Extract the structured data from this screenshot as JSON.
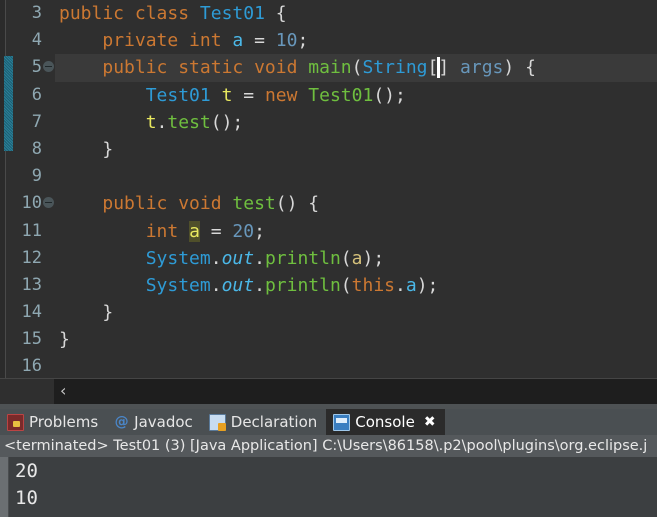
{
  "editor": {
    "first_line_number": 3,
    "current_line": 5,
    "fold_lines": [
      5,
      10
    ],
    "change_bar_lines": [
      5,
      8
    ],
    "line_numbers": [
      3,
      4,
      5,
      6,
      7,
      8,
      9,
      10,
      11,
      12,
      13,
      14,
      15,
      16
    ],
    "lines": [
      {
        "number": 3,
        "text": "public class Test01 {",
        "tokens": [
          {
            "t": "public class ",
            "c": "t-kw"
          },
          {
            "t": "Test01",
            "c": "t-type"
          },
          {
            "t": " {",
            "c": "t-pl"
          }
        ]
      },
      {
        "number": 4,
        "text": "    private int a = 10;",
        "tokens": [
          {
            "t": "    ",
            "c": "t-pl"
          },
          {
            "t": "private int ",
            "c": "t-kw"
          },
          {
            "t": "a",
            "c": "t-field"
          },
          {
            "t": " = ",
            "c": "t-pl"
          },
          {
            "t": "10",
            "c": "t-num"
          },
          {
            "t": ";",
            "c": "t-pl"
          }
        ]
      },
      {
        "number": 5,
        "text": "    public static void main(String[] args) {",
        "tokens": [
          {
            "t": "    ",
            "c": "t-pl"
          },
          {
            "t": "public static void ",
            "c": "t-kw"
          },
          {
            "t": "main",
            "c": "t-fn"
          },
          {
            "t": "(",
            "c": "t-pl"
          },
          {
            "t": "String",
            "c": "t-type"
          },
          {
            "t": "[",
            "c": "t-pl"
          },
          {
            "t": "CARET",
            "c": "caret"
          },
          {
            "t": "]",
            "c": "t-pl"
          },
          {
            "t": " ",
            "c": "t-pl"
          },
          {
            "t": "args",
            "c": "t-num"
          },
          {
            "t": ") {",
            "c": "t-pl"
          }
        ]
      },
      {
        "number": 6,
        "text": "        Test01 t = new Test01();",
        "tokens": [
          {
            "t": "        ",
            "c": "t-pl"
          },
          {
            "t": "Test01",
            "c": "t-type"
          },
          {
            "t": " ",
            "c": "t-pl"
          },
          {
            "t": "t",
            "c": "t-var"
          },
          {
            "t": " = ",
            "c": "t-pl"
          },
          {
            "t": "new",
            "c": "t-kw"
          },
          {
            "t": " ",
            "c": "t-pl"
          },
          {
            "t": "Test01",
            "c": "t-fn"
          },
          {
            "t": "();",
            "c": "t-pl"
          }
        ]
      },
      {
        "number": 7,
        "text": "        t.test();",
        "tokens": [
          {
            "t": "        ",
            "c": "t-pl"
          },
          {
            "t": "t",
            "c": "t-var"
          },
          {
            "t": ".",
            "c": "t-pl"
          },
          {
            "t": "test",
            "c": "t-fn"
          },
          {
            "t": "();",
            "c": "t-pl"
          }
        ]
      },
      {
        "number": 8,
        "text": "    }",
        "tokens": [
          {
            "t": "    }",
            "c": "t-pl"
          }
        ]
      },
      {
        "number": 9,
        "text": "",
        "tokens": [
          {
            "t": "",
            "c": "t-pl"
          }
        ]
      },
      {
        "number": 10,
        "text": "    public void test() {",
        "tokens": [
          {
            "t": "    ",
            "c": "t-pl"
          },
          {
            "t": "public void ",
            "c": "t-kw"
          },
          {
            "t": "test",
            "c": "t-fn"
          },
          {
            "t": "() {",
            "c": "t-pl"
          }
        ]
      },
      {
        "number": 11,
        "text": "        int a = 20;",
        "tokens": [
          {
            "t": "        ",
            "c": "t-pl"
          },
          {
            "t": "int",
            "c": "t-kw"
          },
          {
            "t": " ",
            "c": "t-pl"
          },
          {
            "t": "a",
            "c": "t-hl"
          },
          {
            "t": " = ",
            "c": "t-pl"
          },
          {
            "t": "20",
            "c": "t-num"
          },
          {
            "t": ";",
            "c": "t-pl"
          }
        ]
      },
      {
        "number": 12,
        "text": "        System.out.println(a);",
        "tokens": [
          {
            "t": "        ",
            "c": "t-pl"
          },
          {
            "t": "System",
            "c": "t-type"
          },
          {
            "t": ".",
            "c": "t-pl"
          },
          {
            "t": "out",
            "c": "t-field t-italic"
          },
          {
            "t": ".",
            "c": "t-pl"
          },
          {
            "t": "println",
            "c": "t-fn"
          },
          {
            "t": "(",
            "c": "t-pl"
          },
          {
            "t": "a",
            "c": "t-hl2"
          },
          {
            "t": ");",
            "c": "t-pl"
          }
        ]
      },
      {
        "number": 13,
        "text": "        System.out.println(this.a);",
        "tokens": [
          {
            "t": "        ",
            "c": "t-pl"
          },
          {
            "t": "System",
            "c": "t-type"
          },
          {
            "t": ".",
            "c": "t-pl"
          },
          {
            "t": "out",
            "c": "t-field t-italic"
          },
          {
            "t": ".",
            "c": "t-pl"
          },
          {
            "t": "println",
            "c": "t-fn"
          },
          {
            "t": "(",
            "c": "t-pl"
          },
          {
            "t": "this",
            "c": "t-kw"
          },
          {
            "t": ".",
            "c": "t-pl"
          },
          {
            "t": "a",
            "c": "t-field"
          },
          {
            "t": ");",
            "c": "t-pl"
          }
        ]
      },
      {
        "number": 14,
        "text": "    }",
        "tokens": [
          {
            "t": "    }",
            "c": "t-pl"
          }
        ]
      },
      {
        "number": 15,
        "text": "}",
        "tokens": [
          {
            "t": "}",
            "c": "t-pl"
          }
        ]
      },
      {
        "number": 16,
        "text": "",
        "tokens": [
          {
            "t": "",
            "c": "t-pl"
          }
        ]
      }
    ],
    "scrollbar": {
      "left_arrow": "‹"
    }
  },
  "bottom_panel": {
    "tabs": [
      {
        "label": "Problems",
        "icon": "problems-icon",
        "active": false,
        "closable": false
      },
      {
        "label": "Javadoc",
        "icon": "javadoc-icon",
        "active": false,
        "closable": false
      },
      {
        "label": "Declaration",
        "icon": "declaration-icon",
        "active": false,
        "closable": false
      },
      {
        "label": "Console",
        "icon": "console-icon",
        "active": true,
        "closable": true
      }
    ],
    "close_glyph": "✖",
    "javadoc_glyph": "@",
    "terminated_line": "<terminated> Test01 (3) [Java Application] C:\\Users\\86158\\.p2\\pool\\plugins\\org.eclipse.j",
    "console_output": [
      "20",
      "10"
    ]
  },
  "colors": {
    "editor_bg": "#2f2f2f",
    "current_line_bg": "#3a3a3a",
    "gutter_text": "#8fa8b2",
    "keyword": "#cc7832",
    "type": "#2e9bd6",
    "method": "#6fbf3f",
    "local_var": "#e8e85f",
    "field": "#4bb8e8",
    "number": "#6897bb",
    "console_bg": "#3c3f41",
    "tabbar_bg": "#4a4f52",
    "active_tab_bg": "#2b2b2b",
    "terminated_bar_bg": "#55595c",
    "change_bar": "#2a7f97"
  }
}
